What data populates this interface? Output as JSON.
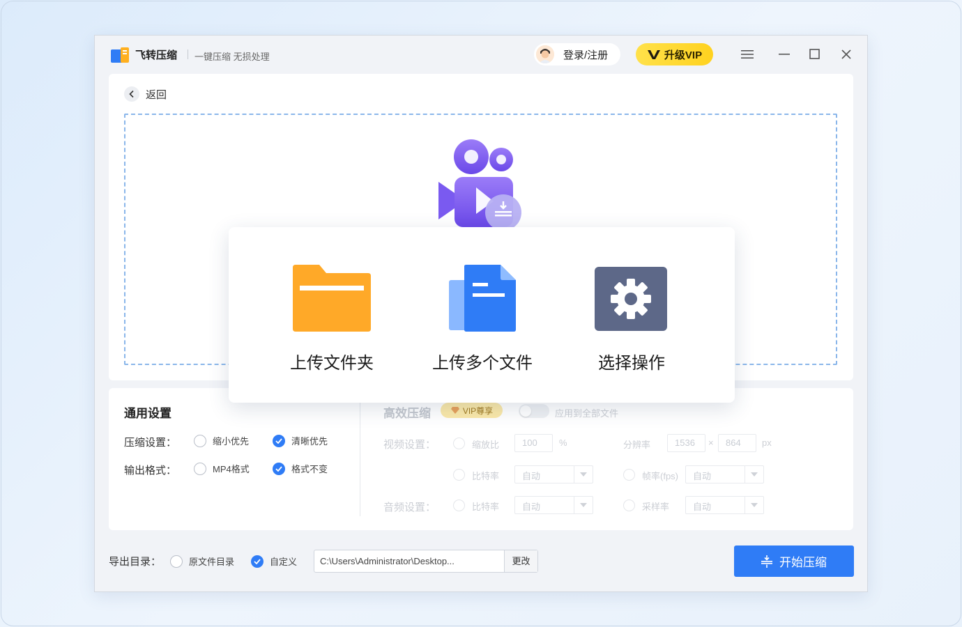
{
  "app": {
    "name": "飞转压缩",
    "slogan": "一键压缩 无损处理",
    "login_label": "登录/注册",
    "vip_label": "升级VIP"
  },
  "upload": {
    "back_label": "返回"
  },
  "popup": {
    "items": [
      {
        "label": "上传文件夹",
        "icon": "folder-icon"
      },
      {
        "label": "上传多个文件",
        "icon": "files-icon"
      },
      {
        "label": "选择操作",
        "icon": "gear-icon"
      }
    ]
  },
  "general_settings": {
    "title": "通用设置",
    "compress_label": "压缩设置：",
    "compress_options": [
      "缩小优先",
      "清晰优先"
    ],
    "compress_selected": "清晰优先",
    "format_label": "输出格式：",
    "format_options": [
      "MP4格式",
      "格式不变"
    ],
    "format_selected": "格式不变"
  },
  "efficient": {
    "title": "高效压缩",
    "vip_tag": "VIP尊享",
    "apply_all_label": "应用到全部文件",
    "video_label": "视频设置：",
    "audio_label": "音频设置：",
    "scale_label": "缩放比",
    "scale_value": "100",
    "scale_unit": "%",
    "resolution_label": "分辨率",
    "res_w": "1536",
    "res_x": "×",
    "res_h": "864",
    "res_unit": "px",
    "bitrate_label": "比特率",
    "bitrate_value": "自动",
    "framerate_label": "帧率(fps)",
    "framerate_value": "自动",
    "audio_bitrate_label": "比特率",
    "audio_bitrate_value": "自动",
    "samplerate_label": "采样率",
    "samplerate_value": "自动"
  },
  "export": {
    "label": "导出目录：",
    "options": [
      "原文件目录",
      "自定义"
    ],
    "selected": "自定义",
    "path": "C:\\Users\\Administrator\\Desktop...",
    "change_label": "更改",
    "start_label": "开始压缩"
  },
  "colors": {
    "accent": "#2f7cf6",
    "vip": "#ffd21f",
    "folder": "#ffa928",
    "gear_bg": "#5d6888",
    "camera": "#7c5cf0"
  }
}
